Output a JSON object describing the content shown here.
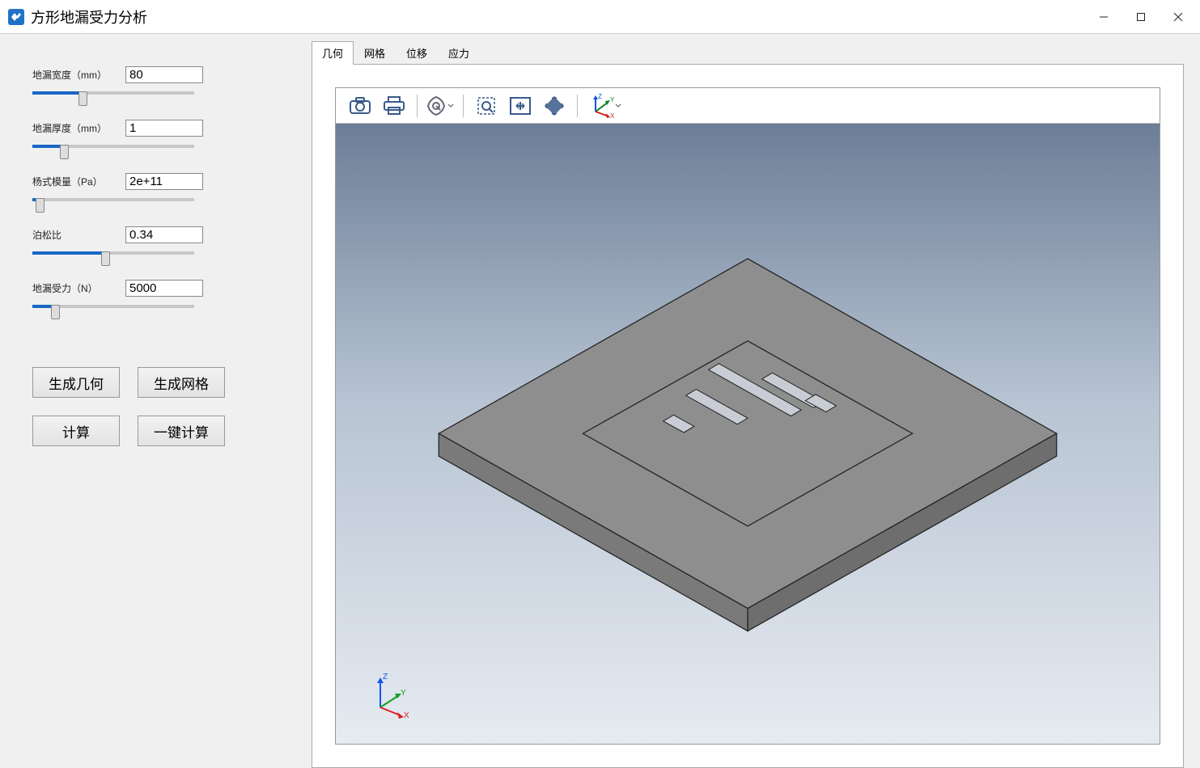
{
  "window": {
    "title": "方形地漏受力分析"
  },
  "params": {
    "width": {
      "label": "地漏宽度（mm）",
      "value": "80",
      "slider": 30
    },
    "thick": {
      "label": "地漏厚度（mm）",
      "value": "1",
      "slider": 18
    },
    "young": {
      "label": "杨式模量（Pa）",
      "value": "2e+11",
      "slider": 2
    },
    "poisson": {
      "label": "泊松比",
      "value": "0.34",
      "slider": 45
    },
    "force": {
      "label": "地漏受力（N）",
      "value": "5000",
      "slider": 12
    }
  },
  "buttons": {
    "gen_geom": "生成几何",
    "gen_mesh": "生成网格",
    "compute": "计算",
    "one_click": "一键计算"
  },
  "tabs": {
    "geometry": "几何",
    "mesh": "网格",
    "displacement": "位移",
    "stress": "应力",
    "active": "geometry"
  },
  "toolbar": {
    "icons": {
      "camera": "camera-icon",
      "print": "print-icon",
      "settings": "gear-icon",
      "zoomarea": "zoom-area-icon",
      "fit": "fit-view-icon",
      "zoomsel": "zoom-selection-icon",
      "triad": "triad-icon"
    }
  },
  "axis_labels": {
    "x": "X",
    "y": "Y",
    "z": "Z"
  }
}
